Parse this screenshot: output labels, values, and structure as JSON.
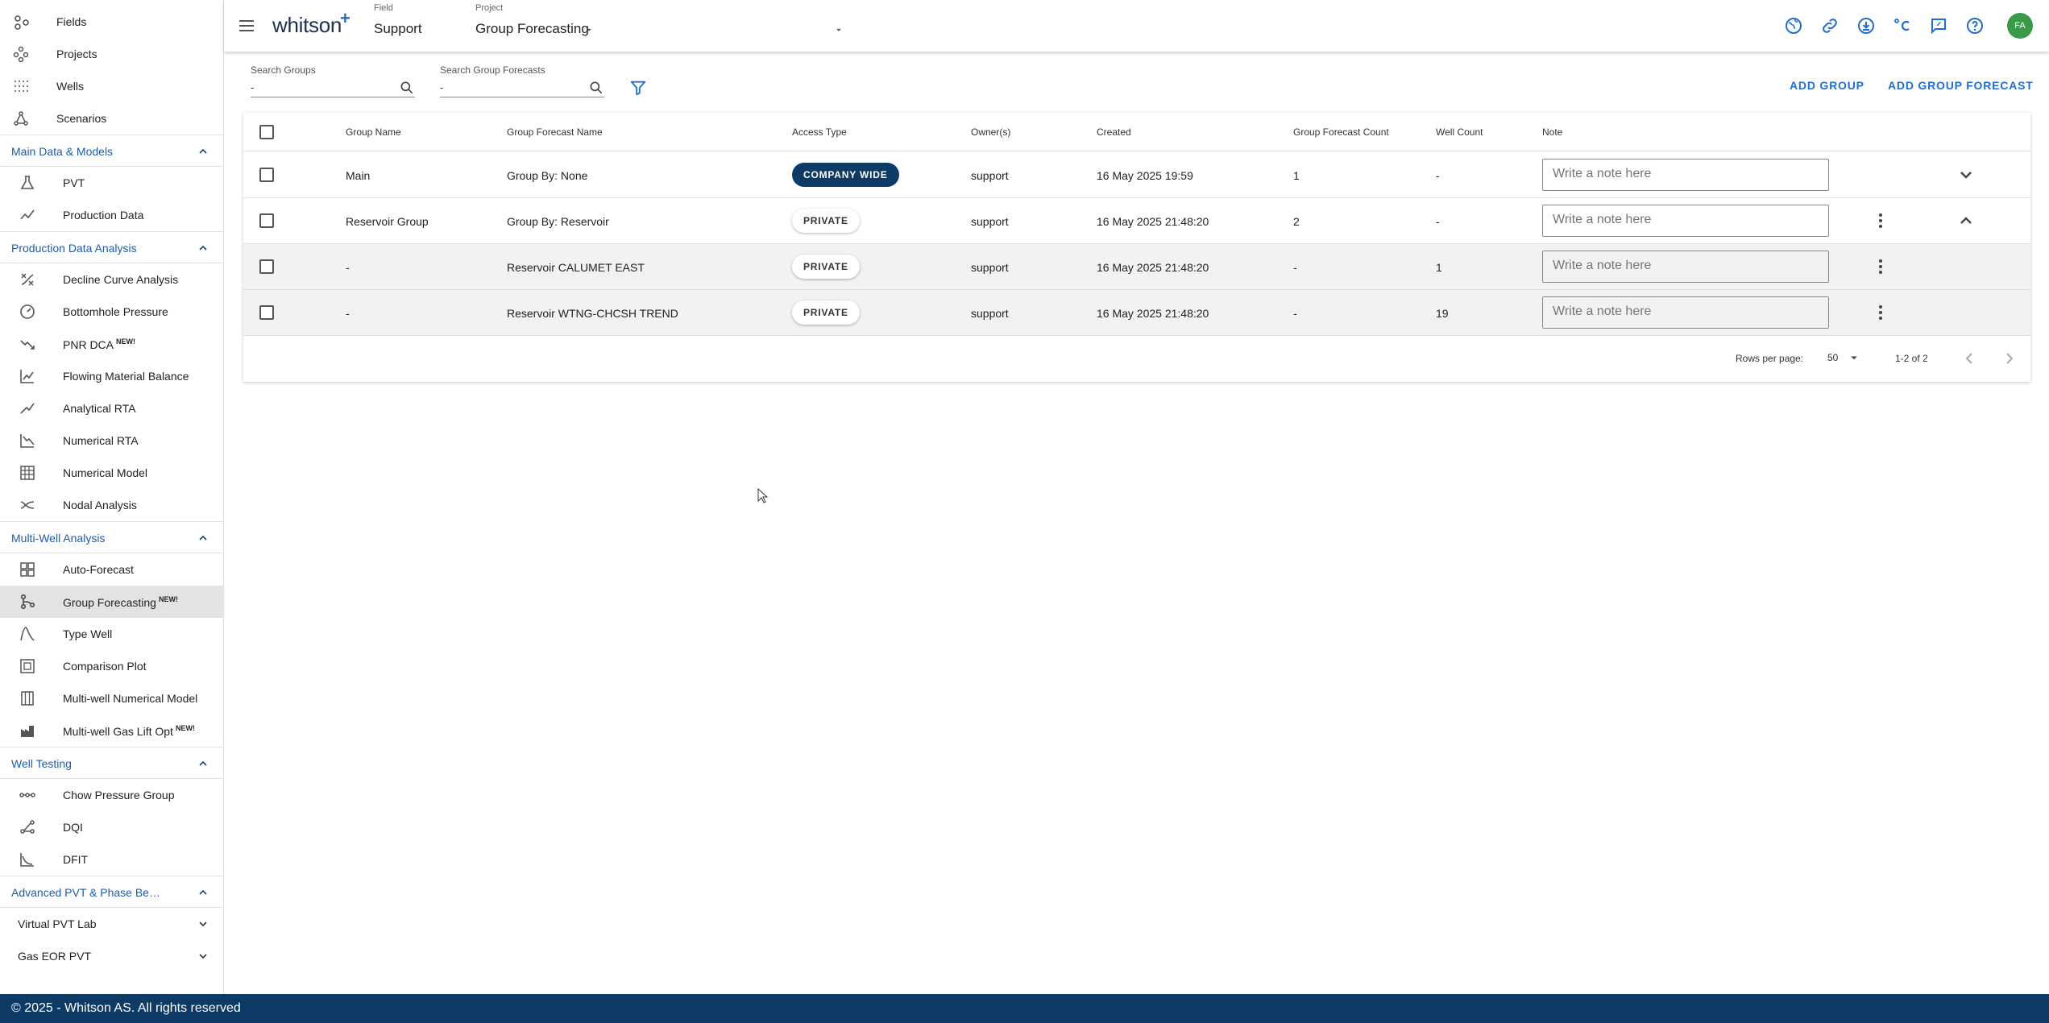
{
  "app": {
    "name": "whitson",
    "plus": "+"
  },
  "topbar": {
    "field_caption": "Field",
    "field_value": "Support",
    "project_caption": "Project",
    "project_value": "Group Forecasting",
    "avatar_initials": "FA",
    "icons": [
      "globe-icon",
      "link-icon",
      "download-icon",
      "celsius-icon",
      "feedback-icon",
      "help-icon"
    ]
  },
  "sidebar": {
    "top_items": [
      {
        "label": "Fields",
        "icon": "fields-icon"
      },
      {
        "label": "Projects",
        "icon": "projects-icon"
      },
      {
        "label": "Wells",
        "icon": "wells-icon"
      },
      {
        "label": "Scenarios",
        "icon": "scenarios-icon"
      }
    ],
    "sections": [
      {
        "label": "Main Data & Models",
        "items": [
          {
            "label": "PVT",
            "icon": "flask-icon"
          },
          {
            "label": "Production Data",
            "icon": "trend-icon"
          }
        ]
      },
      {
        "label": "Production Data Analysis",
        "items": [
          {
            "label": "Decline Curve Analysis",
            "icon": "dca-icon"
          },
          {
            "label": "Bottomhole Pressure",
            "icon": "gauge-icon"
          },
          {
            "label": "PNR DCA",
            "badge": "NEW!",
            "icon": "decline-icon"
          },
          {
            "label": "Flowing Material Balance",
            "icon": "chart-icon"
          },
          {
            "label": "Analytical RTA",
            "icon": "line-icon"
          },
          {
            "label": "Numerical RTA",
            "icon": "numerical-rta-icon"
          },
          {
            "label": "Numerical Model",
            "icon": "grid-model-icon"
          },
          {
            "label": "Nodal Analysis",
            "icon": "nodal-icon"
          }
        ]
      },
      {
        "label": "Multi-Well Analysis",
        "items": [
          {
            "label": "Auto-Forecast",
            "icon": "auto-forecast-icon"
          },
          {
            "label": "Group Forecasting",
            "badge": "NEW!",
            "icon": "group-forecast-icon",
            "selected": true
          },
          {
            "label": "Type Well",
            "icon": "type-well-icon"
          },
          {
            "label": "Comparison Plot",
            "icon": "comparison-icon"
          },
          {
            "label": "Multi-well Numerical Model",
            "icon": "multiwell-model-icon"
          },
          {
            "label": "Multi-well Gas Lift Opt",
            "badge": "NEW!",
            "icon": "gas-lift-icon"
          }
        ]
      },
      {
        "label": "Well Testing",
        "items": [
          {
            "label": "Chow Pressure Group",
            "icon": "chow-icon"
          },
          {
            "label": "DQI",
            "icon": "dqi-icon"
          },
          {
            "label": "DFIT",
            "icon": "dfit-icon"
          }
        ]
      },
      {
        "label": "Advanced PVT & Phase Beha...",
        "items": []
      }
    ],
    "collapsed_groups": [
      "Virtual PVT Lab",
      "Gas EOR PVT"
    ]
  },
  "toolbar": {
    "search_groups_label": "Search Groups",
    "search_groups_value": "-",
    "search_forecasts_label": "Search Group Forecasts",
    "search_forecasts_value": "-",
    "add_group": "ADD GROUP",
    "add_group_forecast": "ADD GROUP FORECAST"
  },
  "table": {
    "columns": [
      "Group Name",
      "Group Forecast Name",
      "Access Type",
      "Owner(s)",
      "Created",
      "Group Forecast Count",
      "Well Count",
      "Note"
    ],
    "note_placeholder": "Write a note here",
    "rows": [
      {
        "group_name": "Main",
        "forecast_name": "Group By: None",
        "access": "COMPANY WIDE",
        "owner": "support",
        "created": "16 May 2025 19:59",
        "forecast_count": "1",
        "well_count": "-",
        "child": false,
        "expanded": false,
        "kebab": false
      },
      {
        "group_name": "Reservoir Group",
        "forecast_name": "Group By: Reservoir",
        "access": "PRIVATE",
        "owner": "support",
        "created": "16 May 2025 21:48:20",
        "forecast_count": "2",
        "well_count": "-",
        "child": false,
        "expanded": true,
        "kebab": true
      },
      {
        "group_name": "-",
        "forecast_name": "Reservoir CALUMET EAST",
        "access": "PRIVATE",
        "owner": "support",
        "created": "16 May 2025 21:48:20",
        "forecast_count": "-",
        "well_count": "1",
        "child": true,
        "kebab": true
      },
      {
        "group_name": "-",
        "forecast_name": "Reservoir WTNG-CHCSH TREND",
        "access": "PRIVATE",
        "owner": "support",
        "created": "16 May 2025 21:48:20",
        "forecast_count": "-",
        "well_count": "19",
        "child": true,
        "kebab": true
      }
    ],
    "pagination": {
      "rows_per_page_label": "Rows per page:",
      "rows_per_page": "50",
      "range": "1-2 of 2"
    }
  },
  "statusbar": {
    "copyright": "© 2025 - Whitson AS. All rights reserved"
  },
  "colors": {
    "accent": "#1f6fd1",
    "navy": "#0d3b66",
    "section_text": "#1f5ba8",
    "avatar": "#3a9a4a"
  }
}
